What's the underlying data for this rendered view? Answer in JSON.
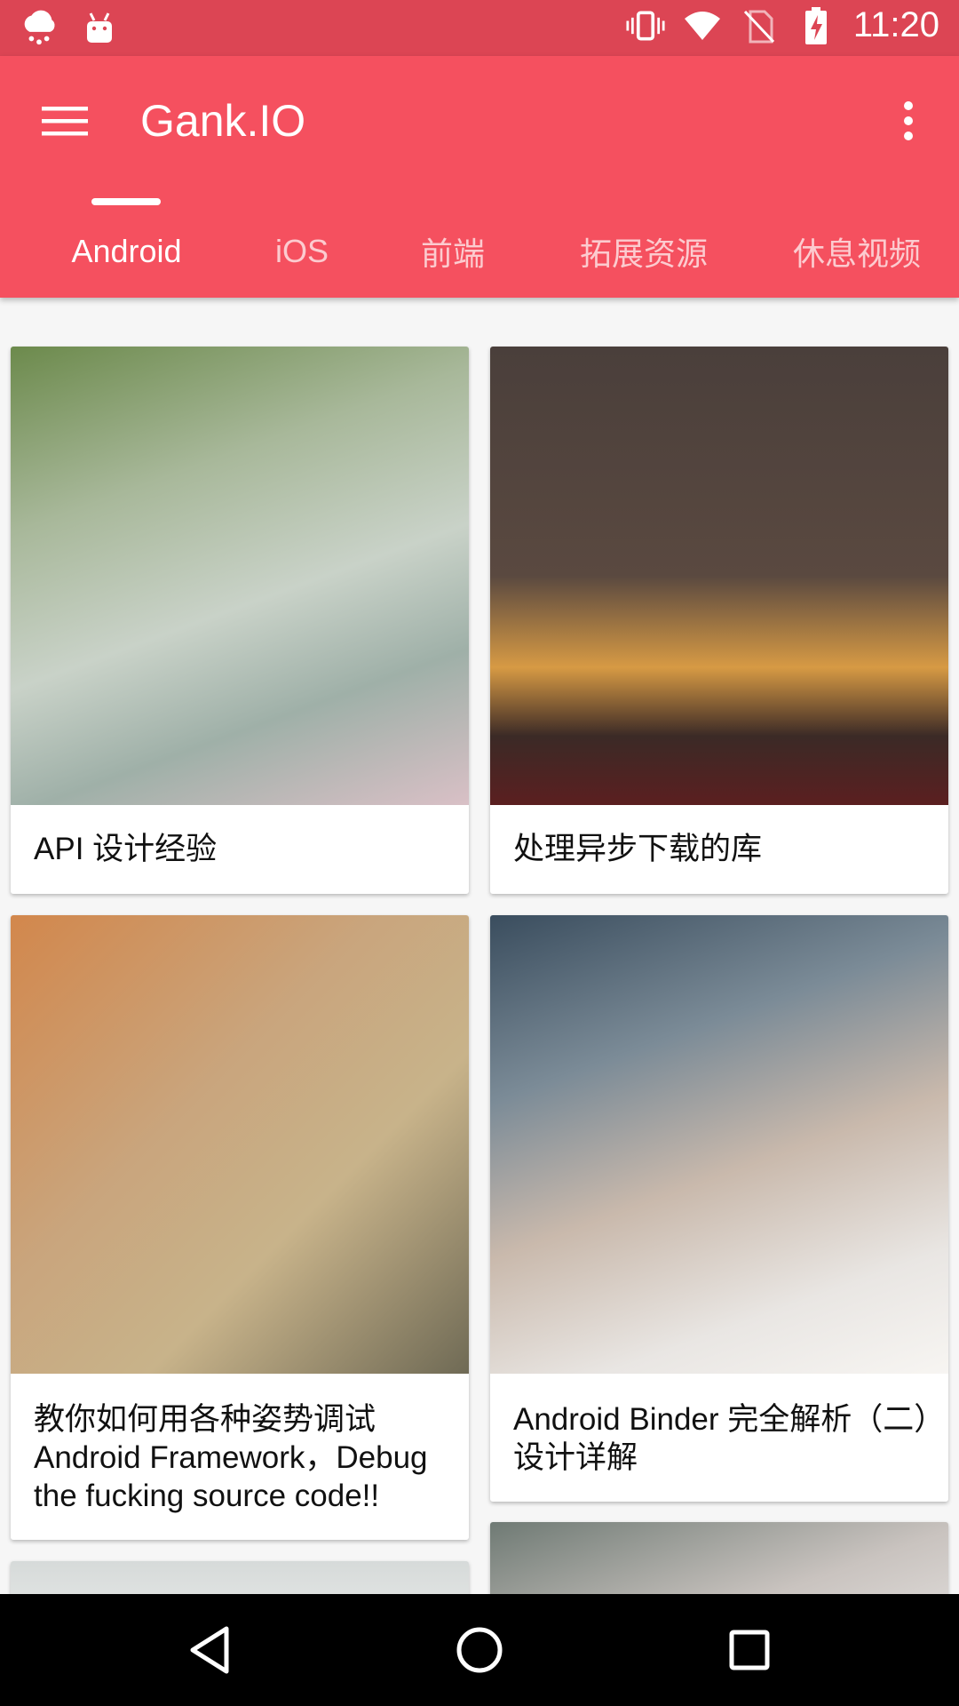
{
  "status_bar": {
    "time": "11:20",
    "left_icons": [
      "weather-cloud-icon",
      "android-icon"
    ],
    "right_icons": [
      "vibrate-icon",
      "wifi-icon",
      "no-sim-icon",
      "battery-charging-icon"
    ]
  },
  "app_bar": {
    "title": "Gank.IO",
    "menu_icon": "hamburger-menu-icon",
    "more_icon": "more-vert-icon",
    "color": "#f5505f"
  },
  "tabs": [
    {
      "label": "Android",
      "active": true
    },
    {
      "label": "iOS",
      "active": false
    },
    {
      "label": "前端",
      "active": false
    },
    {
      "label": "拓展资源",
      "active": false
    },
    {
      "label": "休息视频",
      "active": false
    }
  ],
  "cards": [
    {
      "title": "API 设计经验"
    },
    {
      "title": "处理异步下载的库"
    },
    {
      "title": "教你如何用各种姿势调试 Android Framework，Debug the fucking source code!!"
    },
    {
      "title": "Android Binder 完全解析（二）设计详解"
    }
  ],
  "nav_bar": {
    "back_icon": "back-triangle-icon",
    "home_icon": "home-circle-icon",
    "recents_icon": "recents-square-icon"
  }
}
